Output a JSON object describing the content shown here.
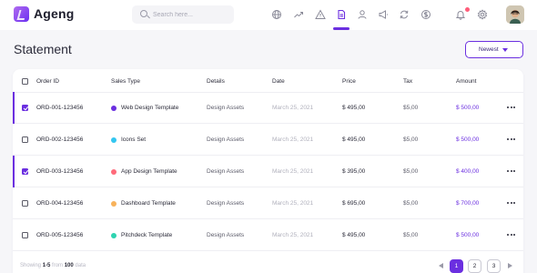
{
  "app": {
    "brand": "Ageng"
  },
  "search": {
    "placeholder": "Search here..."
  },
  "nav": {
    "icons": [
      "globe-icon",
      "trending-icon",
      "alert-triangle-icon",
      "document-icon",
      "user-icon",
      "megaphone-icon",
      "refresh-icon",
      "dollar-icon"
    ],
    "active": "document-icon"
  },
  "header": {
    "title": "Statement",
    "sort_label": "Newest"
  },
  "table": {
    "columns": [
      "Order ID",
      "Sales Type",
      "Details",
      "Date",
      "Price",
      "Tax",
      "Amount"
    ],
    "rows": [
      {
        "order_id": "ORD-001-123456",
        "sales_type": "Web Design Template",
        "dot_color": "#6b2fe0",
        "details": "Design Assets",
        "date": "March 25, 2021",
        "price": "$ 495,00",
        "tax": "$5,00",
        "amount": "$ 500,00",
        "selected": true
      },
      {
        "order_id": "ORD-002-123456",
        "sales_type": "Icons Set",
        "dot_color": "#33c6f0",
        "details": "Design Assets",
        "date": "March 25, 2021",
        "price": "$ 495,00",
        "tax": "$5,00",
        "amount": "$ 500,00",
        "selected": false
      },
      {
        "order_id": "ORD-003-123456",
        "sales_type": "App Design Template",
        "dot_color": "#ff6a7a",
        "details": "Design Assets",
        "date": "March 25, 2021",
        "price": "$ 395,00",
        "tax": "$5,00",
        "amount": "$ 400,00",
        "selected": true
      },
      {
        "order_id": "ORD-004-123456",
        "sales_type": "Dashboard Template",
        "dot_color": "#f7b25b",
        "details": "Design Assets",
        "date": "March 25, 2021",
        "price": "$ 695,00",
        "tax": "$5,00",
        "amount": "$ 700,00",
        "selected": false
      },
      {
        "order_id": "ORD-005-123456",
        "sales_type": "Pitchdeck Template",
        "dot_color": "#2ed3b0",
        "details": "Design Assets",
        "date": "March 25, 2021",
        "price": "$ 495,00",
        "tax": "$5,00",
        "amount": "$ 500,00",
        "selected": false
      }
    ]
  },
  "footer": {
    "prefix": "Showing",
    "range": "1-5",
    "from_label": "from",
    "total": "100",
    "suffix": "data"
  },
  "pagination": {
    "pages": [
      "1",
      "2",
      "3"
    ],
    "current": "1"
  },
  "colors": {
    "accent": "#6b2fe0",
    "notification": "#ff5d7a"
  }
}
